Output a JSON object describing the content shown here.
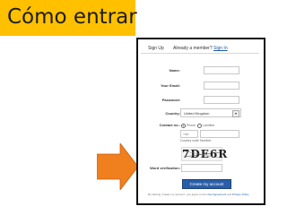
{
  "title": "Cómo entrar",
  "form": {
    "tab_signup": "Sign Up",
    "tab_member": "Already a member?",
    "tab_signin": "Sign In",
    "fields": [
      {
        "label": "Name:"
      },
      {
        "label": "Your Email:"
      },
      {
        "label": "Password:"
      }
    ],
    "country_label": "Country:",
    "country_value": "United Kingdom",
    "contact_label": "Contact no.:",
    "contact_opt1": "Phone",
    "contact_opt2": "Landline",
    "country_code": "+44",
    "country_code_caption": "Country code",
    "number_caption": "Number",
    "captcha_text": "7DE6R",
    "word_verification_label": "Word verification:",
    "create_button": "Create my account",
    "terms_text": "By clicking 'Create my account', you agree to the",
    "terms_link1": "User Agreement",
    "terms_and": "and",
    "terms_link2": "Privacy Policy"
  },
  "colors": {
    "title_bg": "#ffc000",
    "arrow_fill": "#f07f1e",
    "button_bg": "#2a5ea8"
  }
}
